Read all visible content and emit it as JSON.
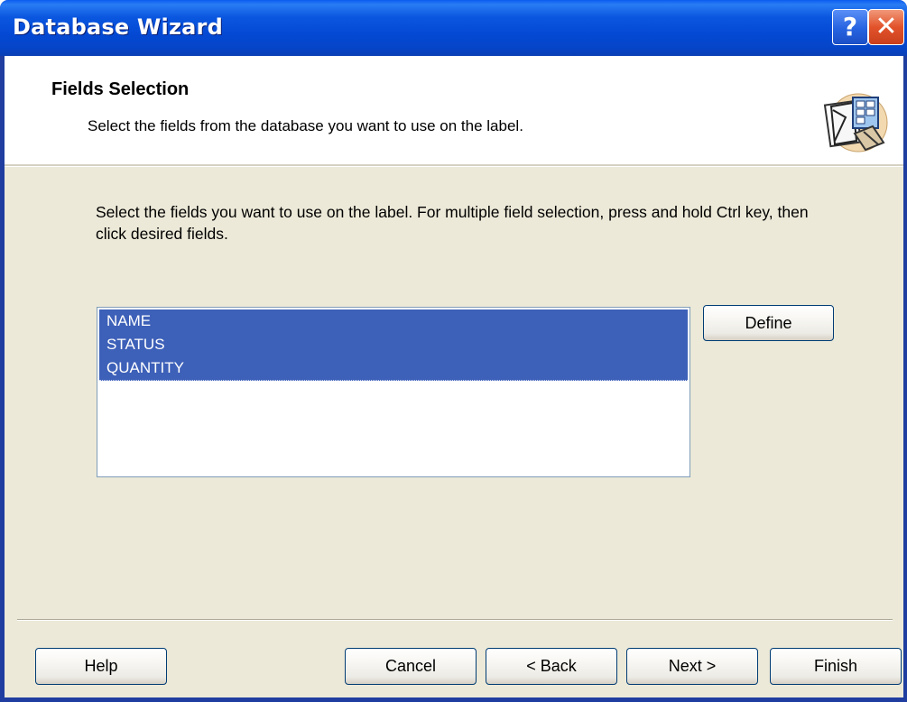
{
  "window": {
    "title": "Database Wizard",
    "help_glyph": "?",
    "close_glyph": "✕"
  },
  "header": {
    "title": "Fields Selection",
    "subtitle": "Select the fields from the database you want to use on the label.",
    "icon": "database-wizard-icon"
  },
  "body": {
    "instruction": "Select the fields you want to use on the label. For multiple field selection, press and hold Ctrl key, then click desired fields."
  },
  "fields_list": {
    "items": [
      "NAME",
      "STATUS",
      "QUANTITY"
    ],
    "selected": [
      "NAME",
      "STATUS",
      "QUANTITY"
    ]
  },
  "buttons": {
    "define": "Define",
    "help": "Help",
    "cancel": "Cancel",
    "back": "< Back",
    "next": "Next >",
    "finish": "Finish"
  },
  "colors": {
    "title_bar": "#0449d4",
    "selection": "#3d60b8",
    "dialog_bg": "#ece9d8",
    "close_button": "#e2532b"
  }
}
